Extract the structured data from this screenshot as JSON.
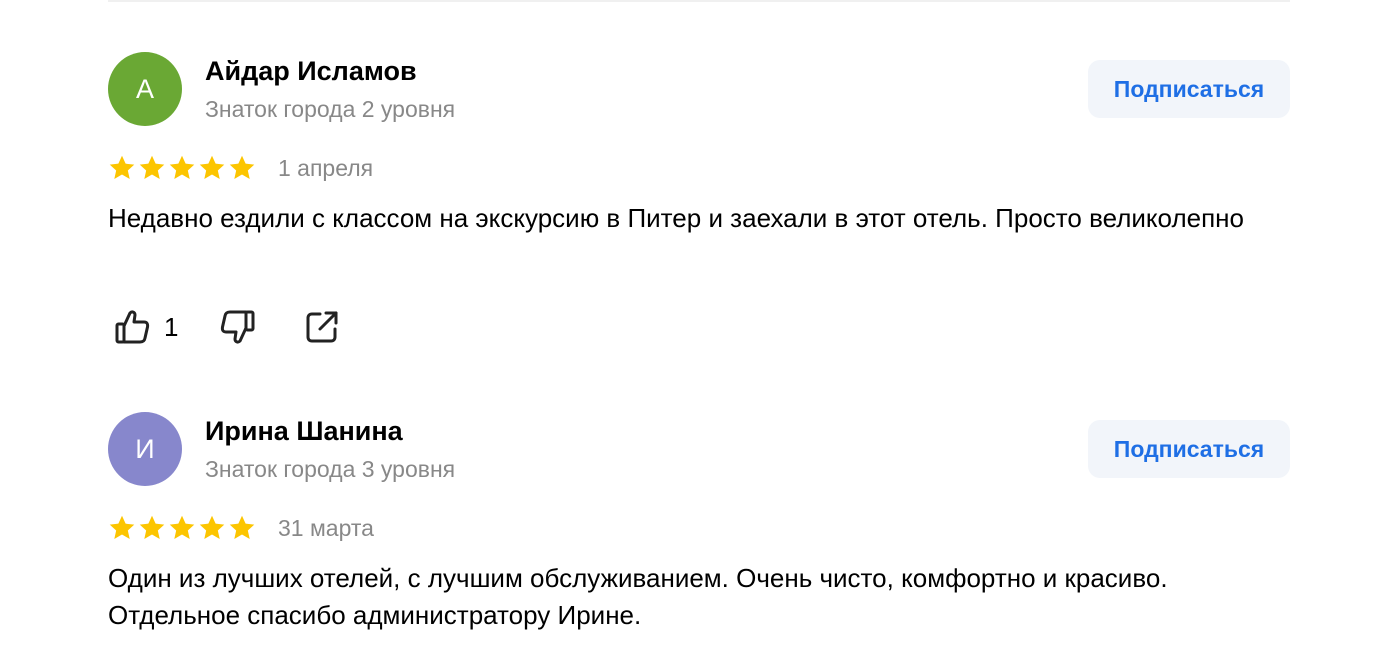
{
  "colors": {
    "star": "#fcc500",
    "subscribe_text": "#1f6fe5",
    "subscribe_bg": "#f2f5fa",
    "secondary_text": "#888888"
  },
  "reviews": [
    {
      "avatar_letter": "А",
      "avatar_color": "#6aa834",
      "author": "Айдар Исламов",
      "level": "Знаток города 2 уровня",
      "subscribe_label": "Подписаться",
      "rating": 5,
      "date": "1 апреля",
      "text": "Недавно ездили с классом на экскурсию в Питер и заехали в этот отель. Просто великолепно",
      "likes": "1",
      "icons": [
        "thumbs-up-icon",
        "thumbs-down-icon",
        "share-icon"
      ]
    },
    {
      "avatar_letter": "И",
      "avatar_color": "#8787cc",
      "author": "Ирина Шанина",
      "level": "Знаток города 3 уровня",
      "subscribe_label": "Подписаться",
      "rating": 5,
      "date": "31 марта",
      "text": "Один из лучших отелей, с лучшим обслуживанием. Очень чисто, комфортно и красиво. Отдельное спасибо администратору Ирине."
    }
  ]
}
